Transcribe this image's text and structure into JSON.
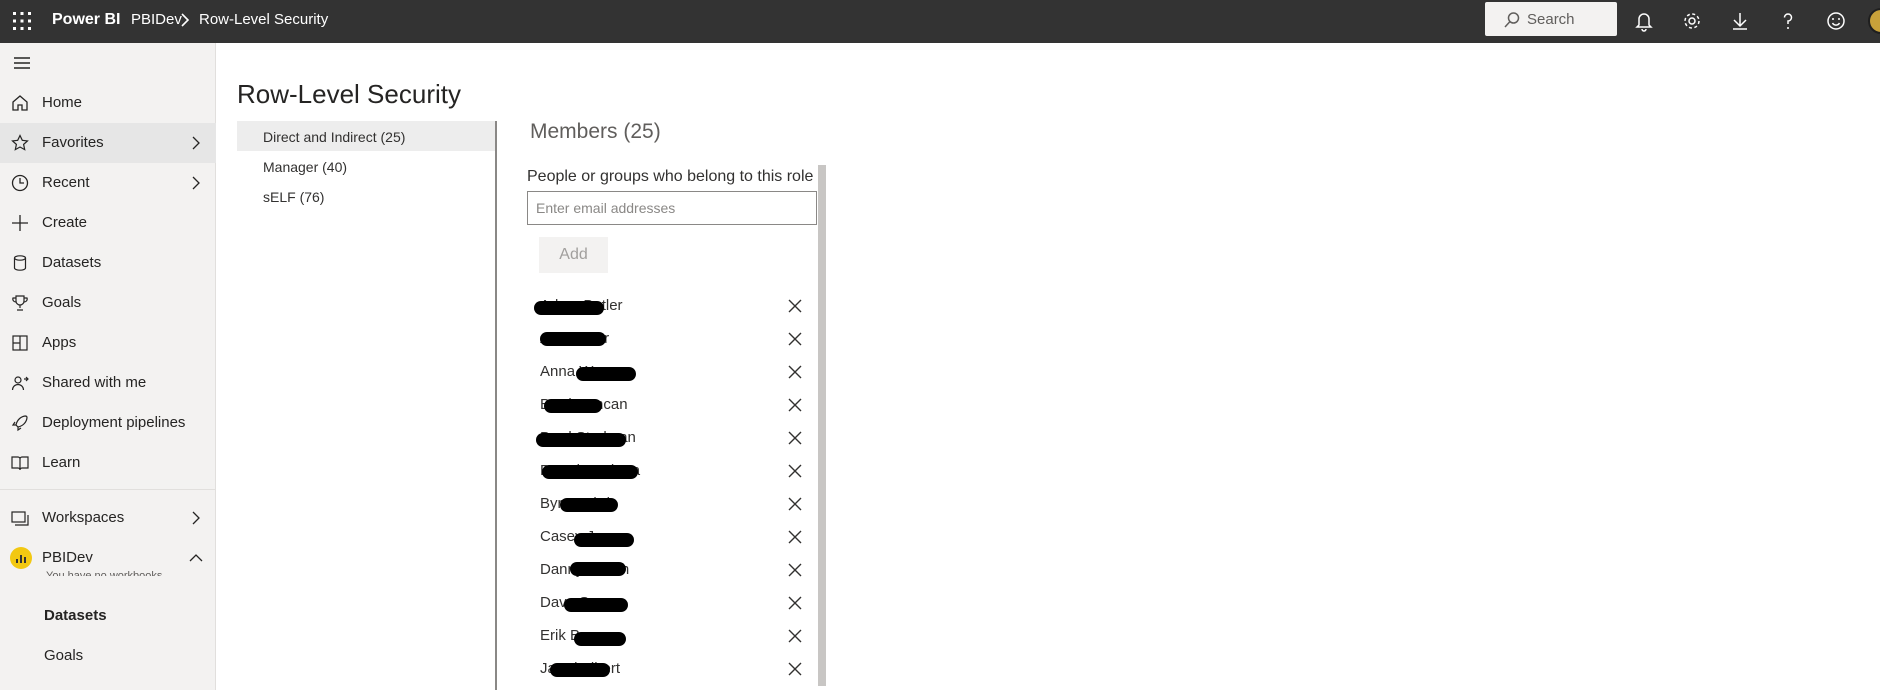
{
  "app": {
    "brand": "Power BI",
    "breadcrumb": [
      "PBIDev",
      "Row-Level Security"
    ]
  },
  "header": {
    "search_placeholder": "Search",
    "icons": [
      "waffle-icon",
      "search-icon",
      "bell-icon",
      "gear-icon",
      "download-icon",
      "help-icon",
      "smiley-icon",
      "avatar"
    ]
  },
  "sidebar": {
    "items": [
      {
        "label": "Home",
        "icon": "home-icon"
      },
      {
        "label": "Favorites",
        "icon": "star-icon",
        "expandable": true
      },
      {
        "label": "Recent",
        "icon": "clock-icon",
        "expandable": true
      },
      {
        "label": "Create",
        "icon": "plus-icon"
      },
      {
        "label": "Datasets",
        "icon": "database-icon"
      },
      {
        "label": "Goals",
        "icon": "trophy-icon"
      },
      {
        "label": "Apps",
        "icon": "apps-icon"
      },
      {
        "label": "Shared with me",
        "icon": "shared-icon"
      },
      {
        "label": "Deployment pipelines",
        "icon": "rocket-icon"
      },
      {
        "label": "Learn",
        "icon": "book-icon"
      }
    ],
    "workspaces_label": "Workspaces",
    "current_workspace": "PBIDev",
    "workspace_hint": "You have no workbooks",
    "workspace_items": [
      "Datasets",
      "Goals"
    ]
  },
  "page": {
    "title": "Row-Level Security"
  },
  "roles": [
    {
      "label": "Direct and Indirect (25)",
      "selected": true
    },
    {
      "label": "Manager (40)",
      "selected": false
    },
    {
      "label": "sELF (76)",
      "selected": false
    }
  ],
  "members": {
    "title": "Members (25)",
    "hint": "People or groups who belong to this role",
    "email_placeholder": "Enter email addresses",
    "add_label": "Add",
    "list": [
      "Adam Butler",
      "Alex Miller",
      "Anna Warren",
      "Brad Duncan",
      "Brad Stedman",
      "Brandon Shota",
      "Byron Bird",
      "Casey Jones",
      "Danny Bosch",
      "Dave Spears",
      "Erik Berger",
      "Jared Albert"
    ]
  },
  "colors": {
    "topbar": "#333333",
    "sidebar": "#f3f2f1",
    "workspace_badge": "#f2c811"
  }
}
